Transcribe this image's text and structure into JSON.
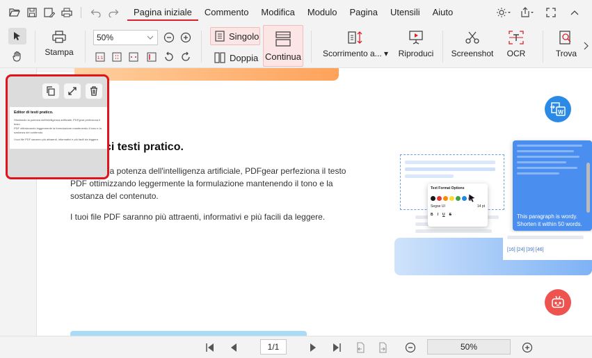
{
  "menu": {
    "items": [
      "Pagina iniziale",
      "Commento",
      "Modifica",
      "Modulo",
      "Pagina",
      "Utensili",
      "Aiuto"
    ],
    "active_index": 0
  },
  "ribbon": {
    "stampa": "Stampa",
    "zoom_value": "50%",
    "singolo": "Singolo",
    "doppia": "Doppia",
    "continua": "Continua",
    "scorrimento": "Scorrimento a...",
    "riproduci": "Riproduci",
    "screenshot": "Screenshot",
    "ocr": "OCR",
    "trova": "Trova"
  },
  "document": {
    "title": "ci testi pratico.",
    "para1_line1": "la potenza dell'intelligenza artificiale, PDFgear perfeziona il testo",
    "para1_line2": "PDF ottimizzando leggermente la formulazione mantenendo il tono e la",
    "para1_line3": "sostanza del contenuto.",
    "para2": "I tuoi file PDF saranno più attraenti, informativi e più facili da leggere."
  },
  "illustration": {
    "format_title": "Text Format Options",
    "font_name": "Segoe UI",
    "font_size": "14 pt",
    "style_buttons": [
      "B",
      "I",
      "U",
      "S"
    ],
    "card_text": "This paragraph is wordy. Shorten it within 50 words.",
    "refs": "[16] [24] [39] [46]",
    "swatches": [
      "#1a1a1a",
      "#e53935",
      "#fb8c00",
      "#fdd835",
      "#43a047",
      "#1e88e5",
      "#8e24aa"
    ]
  },
  "thumbnail": {
    "title": "Editor di testi pratico.",
    "line1": "Sfruttando la potenza dell'intelligenza artificiale, PDFgear perfeziona il testo",
    "line2": "PDF ottimizzando leggermente la formulazione mantenendo il tono e la",
    "line3": "sostanza del contenuto.",
    "line4": "I tuoi file PDF saranno più attraenti, informativi e più facili da leggere."
  },
  "bottombar": {
    "page": "1/1",
    "zoom": "50%"
  },
  "colors": {
    "accent": "#d9202b",
    "word_convert": "#2b8ae6",
    "assistant": "#ef5350",
    "highlight_border": "#e0151c"
  }
}
